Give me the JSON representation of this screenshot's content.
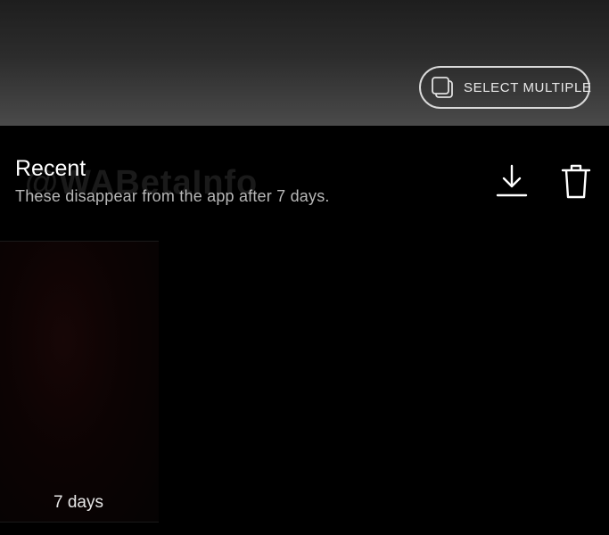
{
  "toolbar": {
    "select_multiple_label": "SELECT MULTIPLE",
    "select_multiple_icon": "stacked-squares-icon"
  },
  "section": {
    "title": "Recent",
    "subtitle": "These disappear from the app after 7 days.",
    "watermark": "@WABetaInfo"
  },
  "actions": {
    "download_icon": "download-icon",
    "delete_icon": "trash-icon"
  },
  "media": [
    {
      "label": "7 days"
    }
  ],
  "colors": {
    "background": "#000000",
    "button_border": "#d9d9d9",
    "subtitle_text": "#b8b8b8"
  }
}
